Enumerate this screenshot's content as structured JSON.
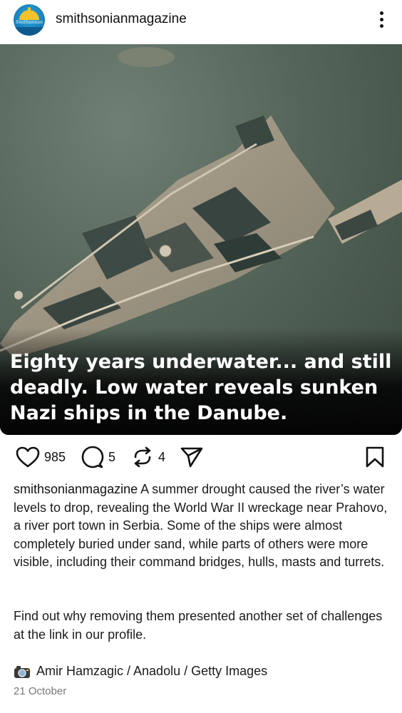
{
  "header": {
    "username": "smithsonianmagazine",
    "avatar_text": "Smithsonian",
    "avatar_icon": "smithsonian-sun-logo",
    "menu_icon": "more-vertical-icon"
  },
  "post": {
    "headline": "Eighty years underwater... and still deadly. Low water reveals sunken Nazi ships in the Danube."
  },
  "actions": {
    "likes": "985",
    "comments": "5",
    "reposts": "4",
    "icons": [
      "heart-icon",
      "comment-icon",
      "repost-icon",
      "send-icon",
      "bookmark-icon"
    ]
  },
  "caption": {
    "username": "smithsonianmagazine",
    "text": " A summer drought caused the river’s water levels to drop, revealing the World War II wreckage near Prahovo, a river port town in Serbia. Some of the ships were almost completely buried under sand, while parts of others were more visible, including their command bridges, hulls, masts and turrets.",
    "paragraph2": "Find out why removing them presented another set of challenges at the link in our profile.",
    "credit": "Amir Hamzagic / Anadolu / Getty Images",
    "date": "21 October"
  },
  "colors": {
    "text": "#111111",
    "muted": "#777777",
    "water": "#556559"
  }
}
